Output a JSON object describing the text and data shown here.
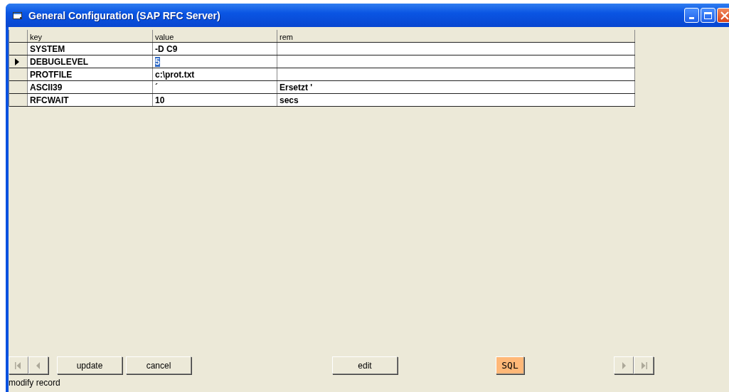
{
  "window": {
    "title": "General Configuration (SAP RFC Server)"
  },
  "table": {
    "columns": [
      "key",
      "value",
      "rem"
    ],
    "rows": [
      {
        "key": "SYSTEM",
        "value": "-D C9",
        "selected": false
      },
      {
        "key": "DEBUGLEVEL",
        "value": "5",
        "selected": true
      },
      {
        "key": "PROTFILE",
        "value": "c:\\prot.txt",
        "selected": false
      },
      {
        "key": "ASCII39",
        "value": "´",
        "rem": "Ersetzt '",
        "selected": false
      },
      {
        "key": "RFCWAIT",
        "value": "10",
        "rem": "secs",
        "selected": false
      }
    ]
  },
  "buttons": [
    {
      "kind": "first",
      "disabled": true
    },
    {
      "kind": "prev",
      "disabled": true
    },
    {
      "kind": "text",
      "label": "update",
      "highlighted": false
    },
    {
      "kind": "text",
      "label": "cancel",
      "highlighted": false
    },
    {
      "kind": "text",
      "label": "edit",
      "highlighted": false
    },
    {
      "kind": "text",
      "label": "SQL",
      "highlighted": true
    },
    {
      "kind": "next",
      "disabled": true
    },
    {
      "kind": "last",
      "disabled": true
    }
  ],
  "status_bar": "modify record"
}
